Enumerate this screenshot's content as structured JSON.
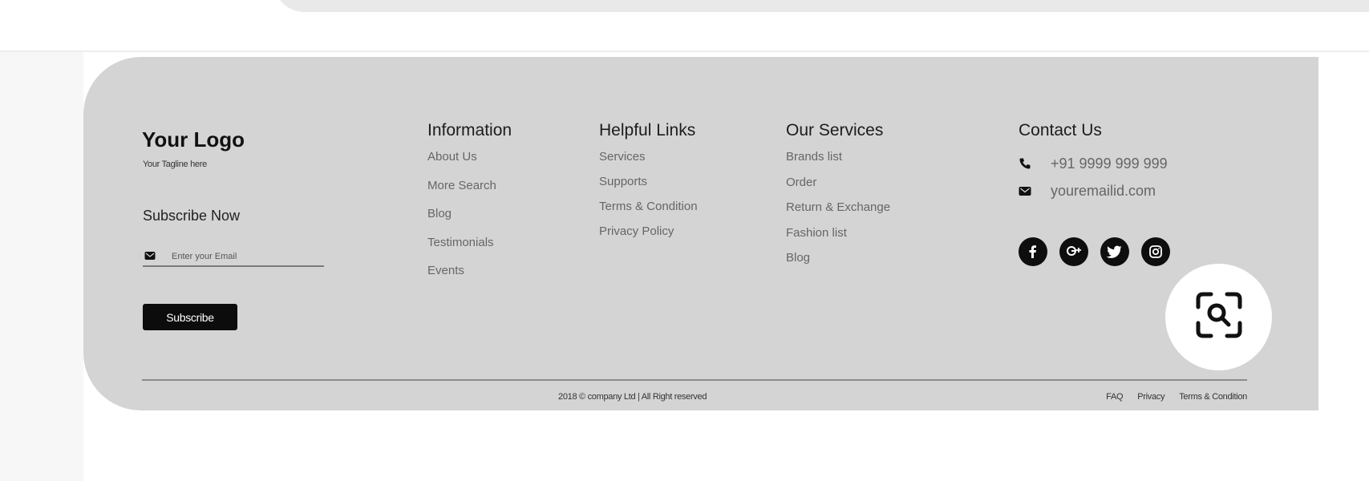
{
  "brand": {
    "logo": "Your Logo",
    "tagline": "Your Tagline here"
  },
  "subscribe": {
    "title": "Subscribe Now",
    "email_placeholder": "Enter your Email",
    "button_label": "Subscribe"
  },
  "columns": {
    "information": {
      "title": "Information",
      "items": [
        "About Us",
        "More Search",
        "Blog",
        "Testimonials",
        "Events"
      ]
    },
    "helpful_links": {
      "title": "Helpful Links",
      "items": [
        "Services",
        "Supports",
        "Terms & Condition",
        "Privacy Policy"
      ]
    },
    "our_services": {
      "title": "Our Services",
      "items": [
        "Brands list",
        "Order",
        "Return & Exchange",
        "Fashion list",
        "Blog"
      ]
    },
    "contact": {
      "title": "Contact Us",
      "phone": "+91 9999 999 999",
      "email": "youremailid.com",
      "phone_icon": "phone-icon",
      "email_icon": "envelope-icon"
    }
  },
  "social_icons": [
    "facebook-icon",
    "google-plus-icon",
    "twitter-icon",
    "instagram-icon"
  ],
  "lens_icon": "visual-search-icon",
  "bottom_bar": {
    "copyright": "2018 © company Ltd | All Right reserved",
    "links": [
      "FAQ",
      "Privacy",
      "Terms & Condition"
    ]
  },
  "colors": {
    "footer_bg": "#d4d4d4",
    "button_bg": "#0c0c0c",
    "social_bg": "#0e0e0e"
  }
}
